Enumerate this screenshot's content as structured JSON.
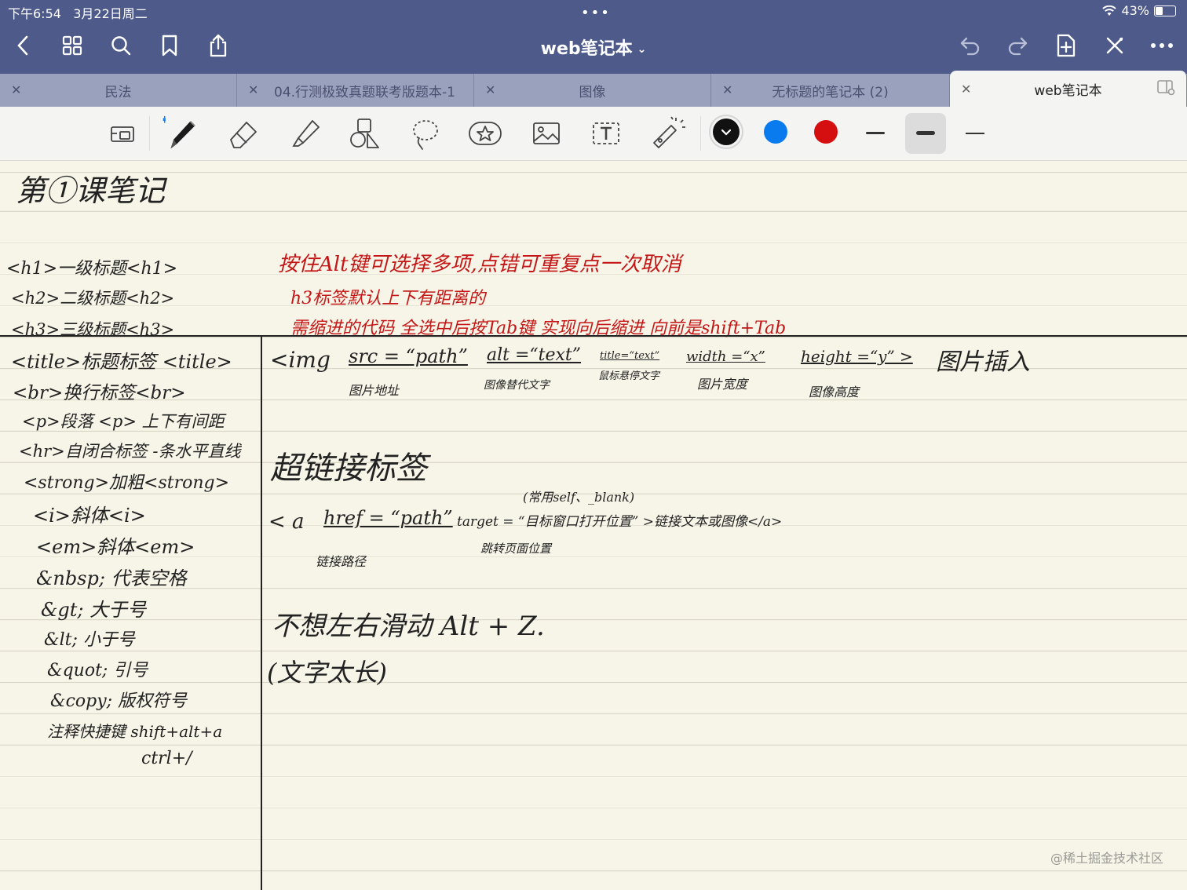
{
  "status": {
    "time": "下午6:54",
    "date": "3月22日周二",
    "battery": "43%",
    "battery_level": 0.43
  },
  "nav": {
    "title": "web笔记本"
  },
  "tabs": [
    {
      "label": "民法",
      "active": false
    },
    {
      "label": "04.行测极致真题联考版题本-1",
      "active": false
    },
    {
      "label": "图像",
      "active": false
    },
    {
      "label": "无标题的笔记本 (2)",
      "active": false
    },
    {
      "label": "web笔记本",
      "active": true
    }
  ],
  "colors": {
    "ink_black": "#111111",
    "ink_blue": "#0a7bef",
    "ink_red": "#d50f0f",
    "topbar": "#4e5b8a"
  },
  "note": {
    "heading": "第①课笔记",
    "red_notes": [
      "按住Alt键可选择多项,点错可重复点一次取消",
      "h3标签默认上下有距离的",
      "需缩进的代码 全选中后按Tab键 实现向后缩进 向前是shift+Tab"
    ],
    "left_lines": [
      "<h1>一级标题<h1>",
      "<h2>二级标题<h2>",
      "<h3>三级标题<h3>",
      "<title>标题标签 <title>",
      "<br>换行标签<br>",
      "<p>段落 <p> 上下有间距",
      "<hr>自闭合标签 -条水平直线",
      "<strong>加粗<strong>",
      "<i>斜体<i>",
      "<em>斜体<em>",
      "&nbsp; 代表空格",
      "&gt; 大于号",
      "&lt; 小于号",
      "&quot; 引号",
      "&copy; 版权符号",
      "注释快捷键 shift+alt+a",
      "ctrl+/"
    ],
    "img_line": {
      "tag": "<img",
      "src": "src = “path”",
      "src_note": "图片地址",
      "alt": "alt =“text”",
      "alt_note": "图像替代文字",
      "title": "title=“text”",
      "title_note": "鼠标悬停文字",
      "width": "width =“x”",
      "width_note": "图片宽度",
      "height": "height =“y” >",
      "height_note": "图像高度",
      "label": "图片插入"
    },
    "link_heading": "超链接标签",
    "link_line": {
      "open": "< a",
      "href": "href = “path”",
      "href_note": "链接路径",
      "target_hint": "(常用self、_blank)",
      "target": "target = “目标窗口打开位置” >链接文本或图像</a>",
      "target_note": "跳转页面位置"
    },
    "scroll_note": "不想左右滑动 Alt + Z.",
    "scroll_reason": "(文字太长)"
  },
  "watermark": "@稀土掘金技术社区"
}
